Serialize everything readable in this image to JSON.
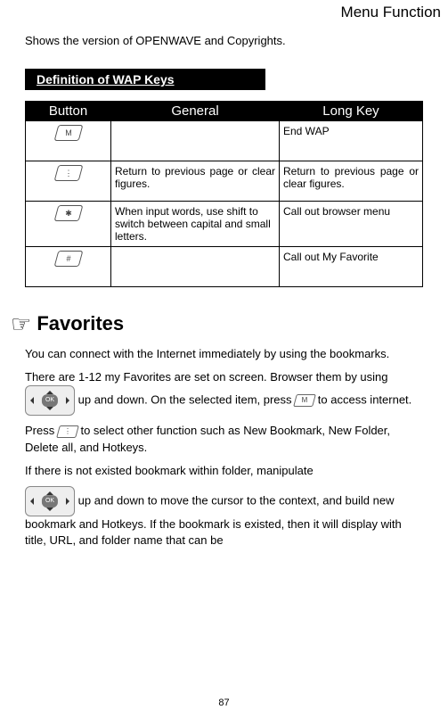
{
  "header_title": "Menu Function",
  "intro_text": "Shows the version of OPENWAVE and Copyrights.",
  "section_header": "Definition of WAP Keys",
  "table": {
    "headers": [
      "Button",
      "General",
      "Long Key"
    ],
    "rows": [
      {
        "glyph": "M",
        "general": "",
        "longkey": "End WAP"
      },
      {
        "glyph": "⋮",
        "general": "Return to previous page or clear figures.",
        "longkey": "Return to previous page or clear figures."
      },
      {
        "glyph": "✱",
        "general": "When input words, use shift to switch between capital and small letters.",
        "longkey": "Call out browser menu"
      },
      {
        "glyph": "#",
        "general": "",
        "longkey": "Call out My Favorite"
      }
    ]
  },
  "favorites": {
    "title": "Favorites",
    "para1": "You can connect with the Internet immediately by using the bookmarks.",
    "para2a": "There are 1-12 my Favorites are set on screen.    Browser them by using ",
    "para2b": " up and down.    On the selected item, press ",
    "para2c": " to access internet.",
    "para3a": "Press ",
    "para3b": " to select other function such as New Bookmark, New Folder, Delete all, and Hotkeys.",
    "para4": "If there is not existed bookmark within folder, manipulate",
    "para5": " up and down to move the cursor to the context, and build new bookmark and Hotkeys.    If the bookmark is existed, then it will display with title, URL, and folder name that can be"
  },
  "page_number": "87"
}
